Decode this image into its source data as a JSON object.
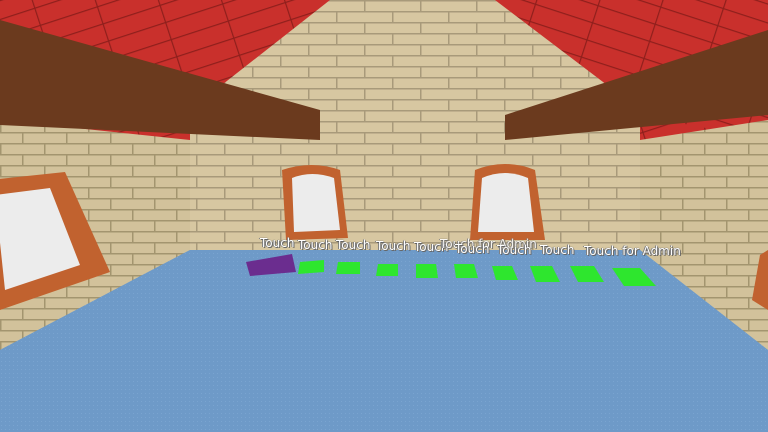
{
  "scene": {
    "pad_labels": [
      "Touch",
      "Touch",
      "Touch",
      "Touch",
      "Touch",
      "Touch for Admin",
      "Touch",
      "Touch",
      "Touch",
      "Touch for Admin"
    ]
  },
  "colors": {
    "roof_red": "#c9302c",
    "beam_brown": "#6b3a1e",
    "brick_tan": "#d6c6a0",
    "window_frame": "#c1622f",
    "window_glass": "#ececec",
    "floor_blue": "#6e9ac8",
    "pad_purple": "#6b2d8f",
    "pad_green": "#2ee62e"
  }
}
